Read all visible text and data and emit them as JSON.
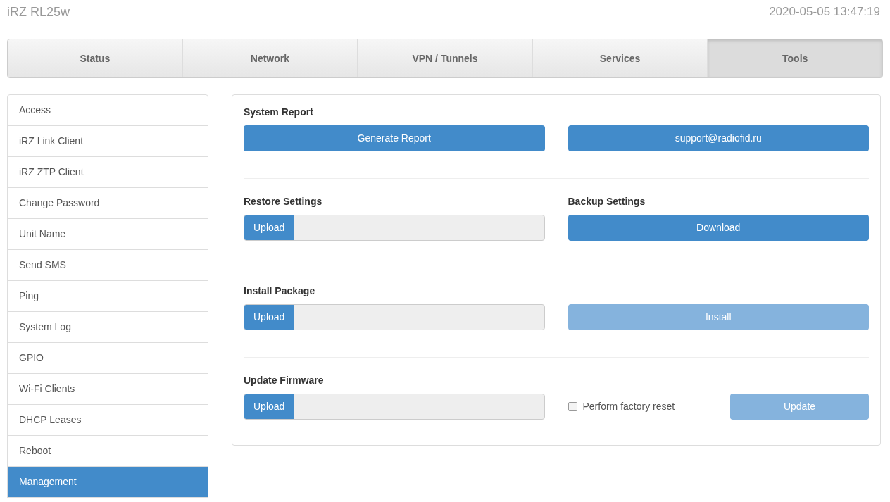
{
  "header": {
    "device": "iRZ RL25w",
    "datetime": "2020-05-05 13:47:19"
  },
  "tabs": [
    {
      "label": "Status",
      "selected": false
    },
    {
      "label": "Network",
      "selected": false
    },
    {
      "label": "VPN / Tunnels",
      "selected": false
    },
    {
      "label": "Services",
      "selected": false
    },
    {
      "label": "Tools",
      "selected": true
    }
  ],
  "sidebar": {
    "items": [
      {
        "label": "Access",
        "selected": false
      },
      {
        "label": "iRZ Link Client",
        "selected": false
      },
      {
        "label": "iRZ ZTP Client",
        "selected": false
      },
      {
        "label": "Change Password",
        "selected": false
      },
      {
        "label": "Unit Name",
        "selected": false
      },
      {
        "label": "Send SMS",
        "selected": false
      },
      {
        "label": "Ping",
        "selected": false
      },
      {
        "label": "System Log",
        "selected": false
      },
      {
        "label": "GPIO",
        "selected": false
      },
      {
        "label": "Wi-Fi Clients",
        "selected": false
      },
      {
        "label": "DHCP Leases",
        "selected": false
      },
      {
        "label": "Reboot",
        "selected": false
      },
      {
        "label": "Management",
        "selected": true
      }
    ]
  },
  "sections": [
    {
      "left": {
        "kind": "button",
        "label": "System Report",
        "button": "Generate Report",
        "disabled": false
      },
      "right": {
        "kind": "button",
        "button": "support@radiofid.ru",
        "disabled": false
      }
    },
    {
      "left": {
        "kind": "upload",
        "label": "Restore Settings",
        "button": "Upload"
      },
      "right": {
        "kind": "button",
        "label": "Backup Settings",
        "button": "Download",
        "disabled": false
      }
    },
    {
      "left": {
        "kind": "upload",
        "label": "Install Package",
        "button": "Upload"
      },
      "right": {
        "kind": "button",
        "button": "Install",
        "disabled": true
      }
    },
    {
      "left": {
        "kind": "upload",
        "label": "Update Firmware",
        "button": "Upload"
      },
      "right": {
        "kind": "checkbox-button",
        "checkbox": {
          "label": "Perform factory reset",
          "checked": false
        },
        "button": "Update",
        "disabled": true
      }
    }
  ]
}
